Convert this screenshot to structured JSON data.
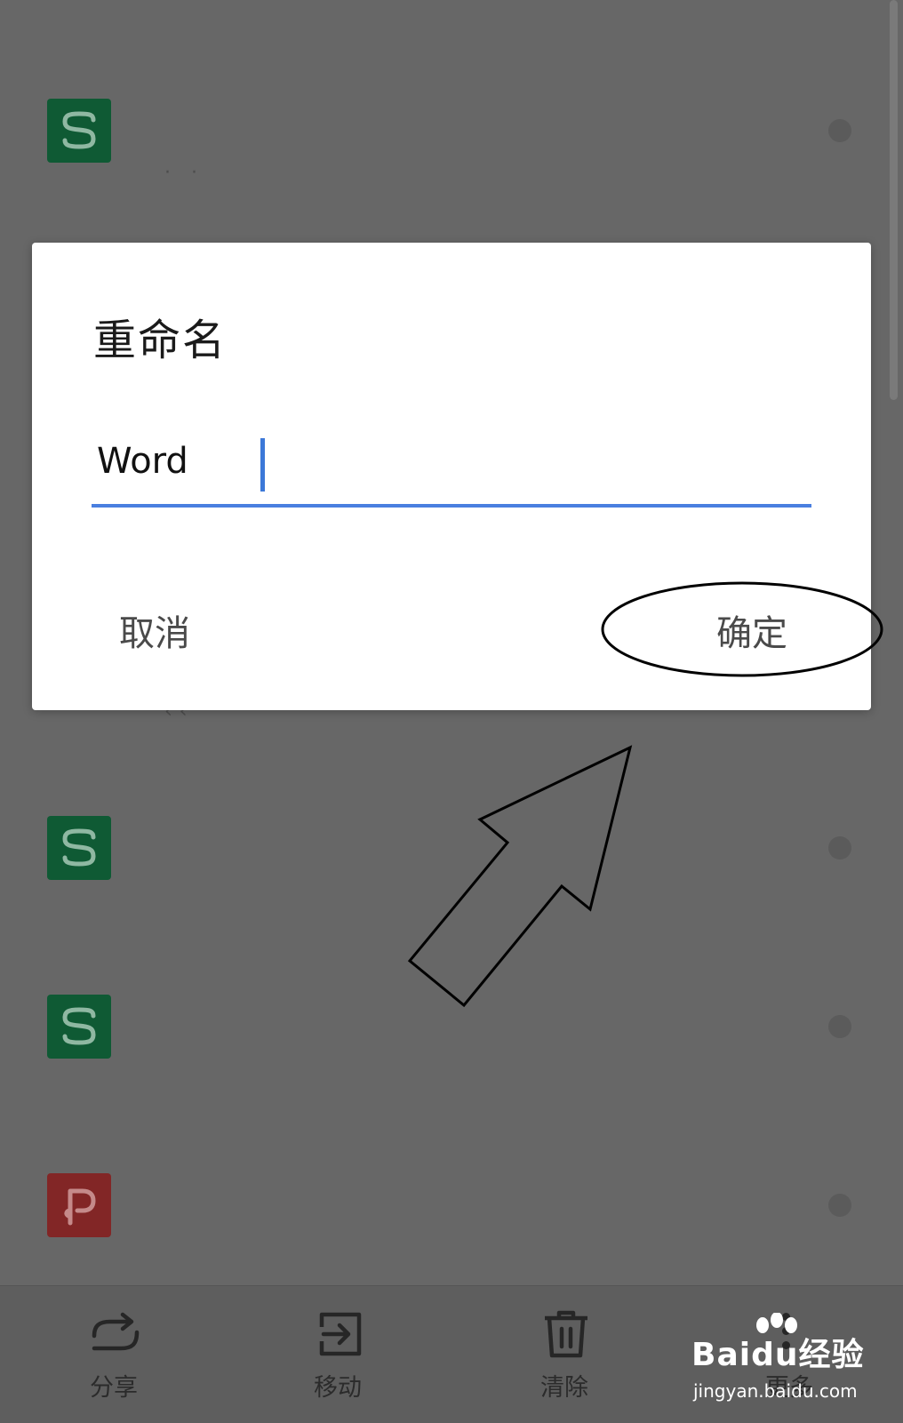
{
  "dialog": {
    "title": "重命名",
    "input_value": "Word",
    "cancel_label": "取消",
    "ok_label": "确定",
    "accent_color": "#4a7fe0"
  },
  "file_list": {
    "items": [
      {
        "type": "sheet",
        "icon": "spreadsheet-icon",
        "letter": "S"
      },
      {
        "type": "sheet",
        "icon": "spreadsheet-icon",
        "letter": "S"
      },
      {
        "type": "sheet",
        "icon": "spreadsheet-icon",
        "letter": "S"
      },
      {
        "type": "presentation",
        "icon": "presentation-icon",
        "letter": "P"
      }
    ],
    "sheet_color": "#0f5a34",
    "presentation_color": "#822626"
  },
  "toolbar": {
    "share_label": "分享",
    "move_label": "移动",
    "clear_label": "清除",
    "more_label": "更多"
  },
  "watermark": {
    "brand": "Baidu经验",
    "url": "jingyan.baidu.com"
  }
}
